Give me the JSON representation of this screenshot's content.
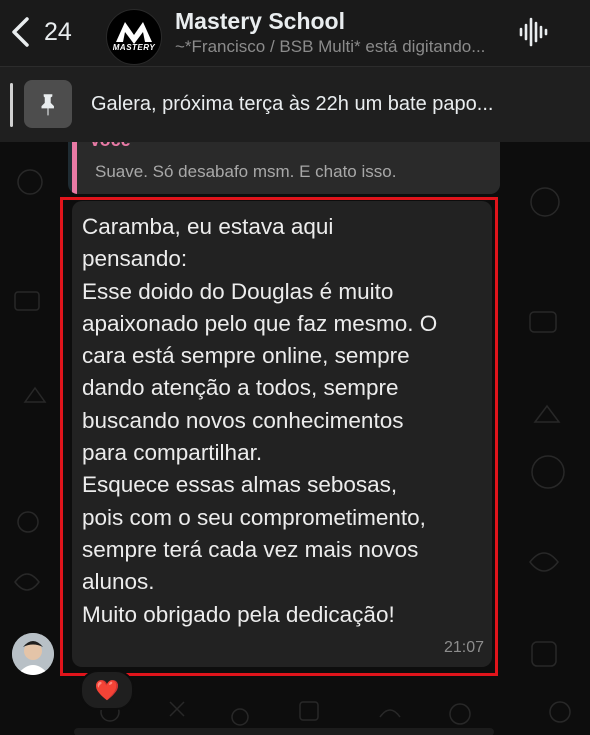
{
  "header": {
    "back_count": "24",
    "title": "Mastery School",
    "subtitle": "~*Francisco / BSB Multi* está digitando...",
    "logo_text": "MASTERY"
  },
  "pinned": {
    "text": "Galera, próxima terça às 22h um bate papo..."
  },
  "quoted": {
    "author": "Você",
    "text": "Suave. Só desabafo msm. E chato isso."
  },
  "message": {
    "text": "Caramba, eu estava aqui\npensando:\nEsse doido do Douglas é muito\napaixonado pelo que faz mesmo. O\ncara está sempre online, sempre\ndando atenção a todos, sempre\nbuscando novos conhecimentos\npara compartilhar.\nEsquece essas almas sebosas,\npois com o seu comprometimento,\nsempre terá cada vez mais novos\nalunos.\nMuito obrigado pela dedicação!",
    "time": "21:07",
    "reaction": "❤️"
  },
  "colors": {
    "highlight": "#e0141b",
    "quote_accent": "#e87aa5",
    "bubble": "#222222",
    "header_bg": "#1a1a1a"
  }
}
